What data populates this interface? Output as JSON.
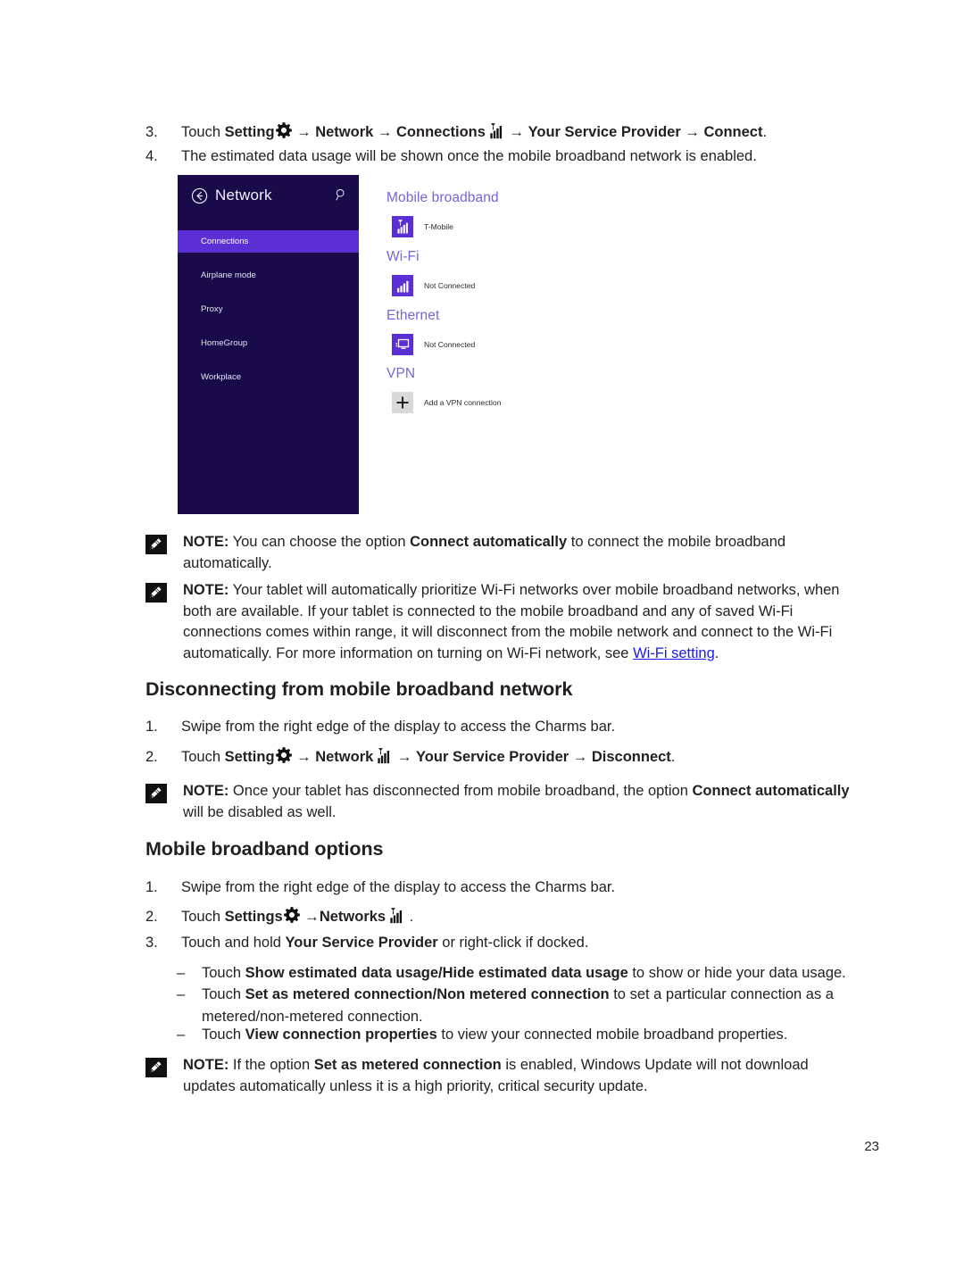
{
  "page": {
    "number": "23"
  },
  "steps_top": [
    {
      "marker": "3.",
      "prefix": "Touch ",
      "b1": "Setting",
      "icon1": "gear-icon",
      "mid1": " → ",
      "b2": "Network",
      "mid2": " → ",
      "b3": "Connections",
      "icon2": "cellular-signal-icon",
      "mid3": " → ",
      "b4": "Your Service Provider",
      "mid4": " → ",
      "b5": "Connect",
      "suffix": "."
    },
    {
      "marker": "4.",
      "text": "The estimated data usage will be shown once the mobile broadband network is enabled."
    }
  ],
  "screenshot": {
    "title": "Network",
    "back_icon": "back-arrow-circle-icon",
    "search_icon": "search-icon",
    "nav_items": [
      {
        "label": "Connections",
        "selected": true
      },
      {
        "label": "Airplane mode",
        "selected": false
      },
      {
        "label": "Proxy",
        "selected": false
      },
      {
        "label": "HomeGroup",
        "selected": false
      },
      {
        "label": "Workplace",
        "selected": false
      }
    ],
    "sections": [
      {
        "title": "Mobile broadband",
        "rows": [
          {
            "label": "T-Mobile",
            "icon": "mobile-broadband-signal-icon",
            "tile": "purple"
          }
        ]
      },
      {
        "title": "Wi-Fi",
        "rows": [
          {
            "label": "Not Connected",
            "icon": "wifi-bars-icon",
            "tile": "purple"
          }
        ]
      },
      {
        "title": "Ethernet",
        "rows": [
          {
            "label": "Not Connected",
            "icon": "ethernet-monitor-icon",
            "tile": "purple"
          }
        ]
      },
      {
        "title": "VPN",
        "rows": [
          {
            "label": "Add a VPN connection",
            "icon": "plus-icon",
            "tile": "gray"
          }
        ]
      }
    ]
  },
  "note1": {
    "icon": "note-pencil-icon",
    "label": "NOTE:",
    "t1": " You can choose the option ",
    "b1": "Connect automatically",
    "t2": " to connect the mobile broadband automatically."
  },
  "note2": {
    "icon": "note-pencil-icon",
    "label": "NOTE:",
    "t1": " Your tablet will automatically prioritize Wi-Fi networks over mobile broadband networks, when both are available. If your tablet is connected to the mobile broadband and any of saved Wi-Fi connections comes within range, it will disconnect from the mobile network and connect to the Wi-Fi automatically. For more information on turning on Wi-Fi network, see ",
    "link": "Wi-Fi setting",
    "t2": "."
  },
  "heading1": "Disconnecting from mobile broadband network",
  "disconnect_steps": [
    {
      "marker": "1.",
      "text": "Swipe from the right edge of the display to access the Charms bar."
    },
    {
      "marker": "2.",
      "prefix": "Touch ",
      "b1": "Setting",
      "icon1": "gear-icon",
      "mid1": " → ",
      "b2": "Network",
      "icon2": "cellular-signal-icon",
      "mid2": " → ",
      "b3": "Your Service Provider",
      "mid3": " → ",
      "b4": "Disconnect",
      "suffix": "."
    }
  ],
  "note3": {
    "icon": "note-pencil-icon",
    "label": "NOTE:",
    "t1": " Once your tablet has disconnected from mobile broadband, the option ",
    "b1": "Connect automatically",
    "t2": " will be disabled as well."
  },
  "heading2": "Mobile broadband options",
  "options_steps": [
    {
      "marker": "1.",
      "text": "Swipe from the right edge of the display to access the Charms bar."
    },
    {
      "marker": "2.",
      "prefix": "Touch ",
      "b1": "Settings",
      "icon1": "gear-icon",
      "mid1": " →",
      "b2": "Networks",
      "icon2": "cellular-signal-icon",
      "suffix": " ."
    },
    {
      "marker": "3.",
      "prefix": "Touch and hold ",
      "b1": "Your Service Provider",
      "suffix": " or right-click if docked."
    }
  ],
  "bullets": [
    {
      "marker": "–",
      "prefix": "Touch ",
      "bold": "Show estimated data usage/Hide estimated data usage",
      "suffix": " to show or hide your data usage."
    },
    {
      "marker": "–",
      "prefix": "Touch ",
      "bold": "Set as metered connection/Non metered connection",
      "suffix": " to set a particular connection as a metered/non-metered connection."
    },
    {
      "marker": "–",
      "prefix": "Touch ",
      "bold": "View connection properties",
      "suffix": " to view your connected mobile broadband properties."
    }
  ],
  "note4": {
    "icon": "note-pencil-icon",
    "label": "NOTE:",
    "t1": " If the option ",
    "b1": "Set as metered connection",
    "t2": " is enabled, Windows Update will not download updates automatically unless it is a high priority, critical security update."
  }
}
